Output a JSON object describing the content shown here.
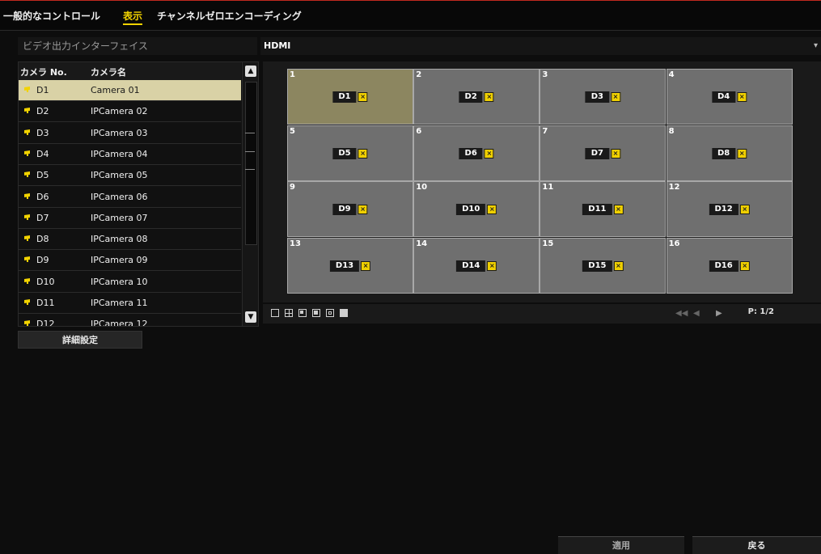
{
  "tabs": [
    {
      "label": "一般的なコントロール"
    },
    {
      "label": "表示"
    },
    {
      "label": "チャンネルゼロエンコーディング"
    }
  ],
  "video_output": {
    "label": "ビデオ出力インターフェイス",
    "value": "HDMI"
  },
  "camera_list": {
    "header_no": "カメラ No.",
    "header_name": "カメラ名",
    "rows": [
      {
        "no": "D1",
        "name": "Camera 01"
      },
      {
        "no": "D2",
        "name": "IPCamera 02"
      },
      {
        "no": "D3",
        "name": "IPCamera 03"
      },
      {
        "no": "D4",
        "name": "IPCamera 04"
      },
      {
        "no": "D5",
        "name": "IPCamera 05"
      },
      {
        "no": "D6",
        "name": "IPCamera 06"
      },
      {
        "no": "D7",
        "name": "IPCamera 07"
      },
      {
        "no": "D8",
        "name": "IPCamera 08"
      },
      {
        "no": "D9",
        "name": "IPCamera 09"
      },
      {
        "no": "D10",
        "name": "IPCamera 10"
      },
      {
        "no": "D11",
        "name": "IPCamera 11"
      },
      {
        "no": "D12",
        "name": "IPCamera 12"
      }
    ],
    "selected_index": 0
  },
  "advanced_button": "詳細設定",
  "layout_grid": {
    "cells": [
      {
        "num": "1",
        "label": "D1"
      },
      {
        "num": "2",
        "label": "D2"
      },
      {
        "num": "3",
        "label": "D3"
      },
      {
        "num": "4",
        "label": "D4"
      },
      {
        "num": "5",
        "label": "D5"
      },
      {
        "num": "6",
        "label": "D6"
      },
      {
        "num": "7",
        "label": "D7"
      },
      {
        "num": "8",
        "label": "D8"
      },
      {
        "num": "9",
        "label": "D9"
      },
      {
        "num": "10",
        "label": "D10"
      },
      {
        "num": "11",
        "label": "D11"
      },
      {
        "num": "12",
        "label": "D12"
      },
      {
        "num": "13",
        "label": "D13"
      },
      {
        "num": "14",
        "label": "D14"
      },
      {
        "num": "15",
        "label": "D15"
      },
      {
        "num": "16",
        "label": "D16"
      }
    ],
    "selected_index": 0
  },
  "pager": {
    "text": "P: 1/2"
  },
  "buttons": {
    "apply": "適用",
    "back": "戻る"
  },
  "colors": {
    "accent": "#f2d300",
    "top_border": "#c0291f",
    "selected_row": "#d9d2a6",
    "selected_cell": "#8c8660"
  }
}
